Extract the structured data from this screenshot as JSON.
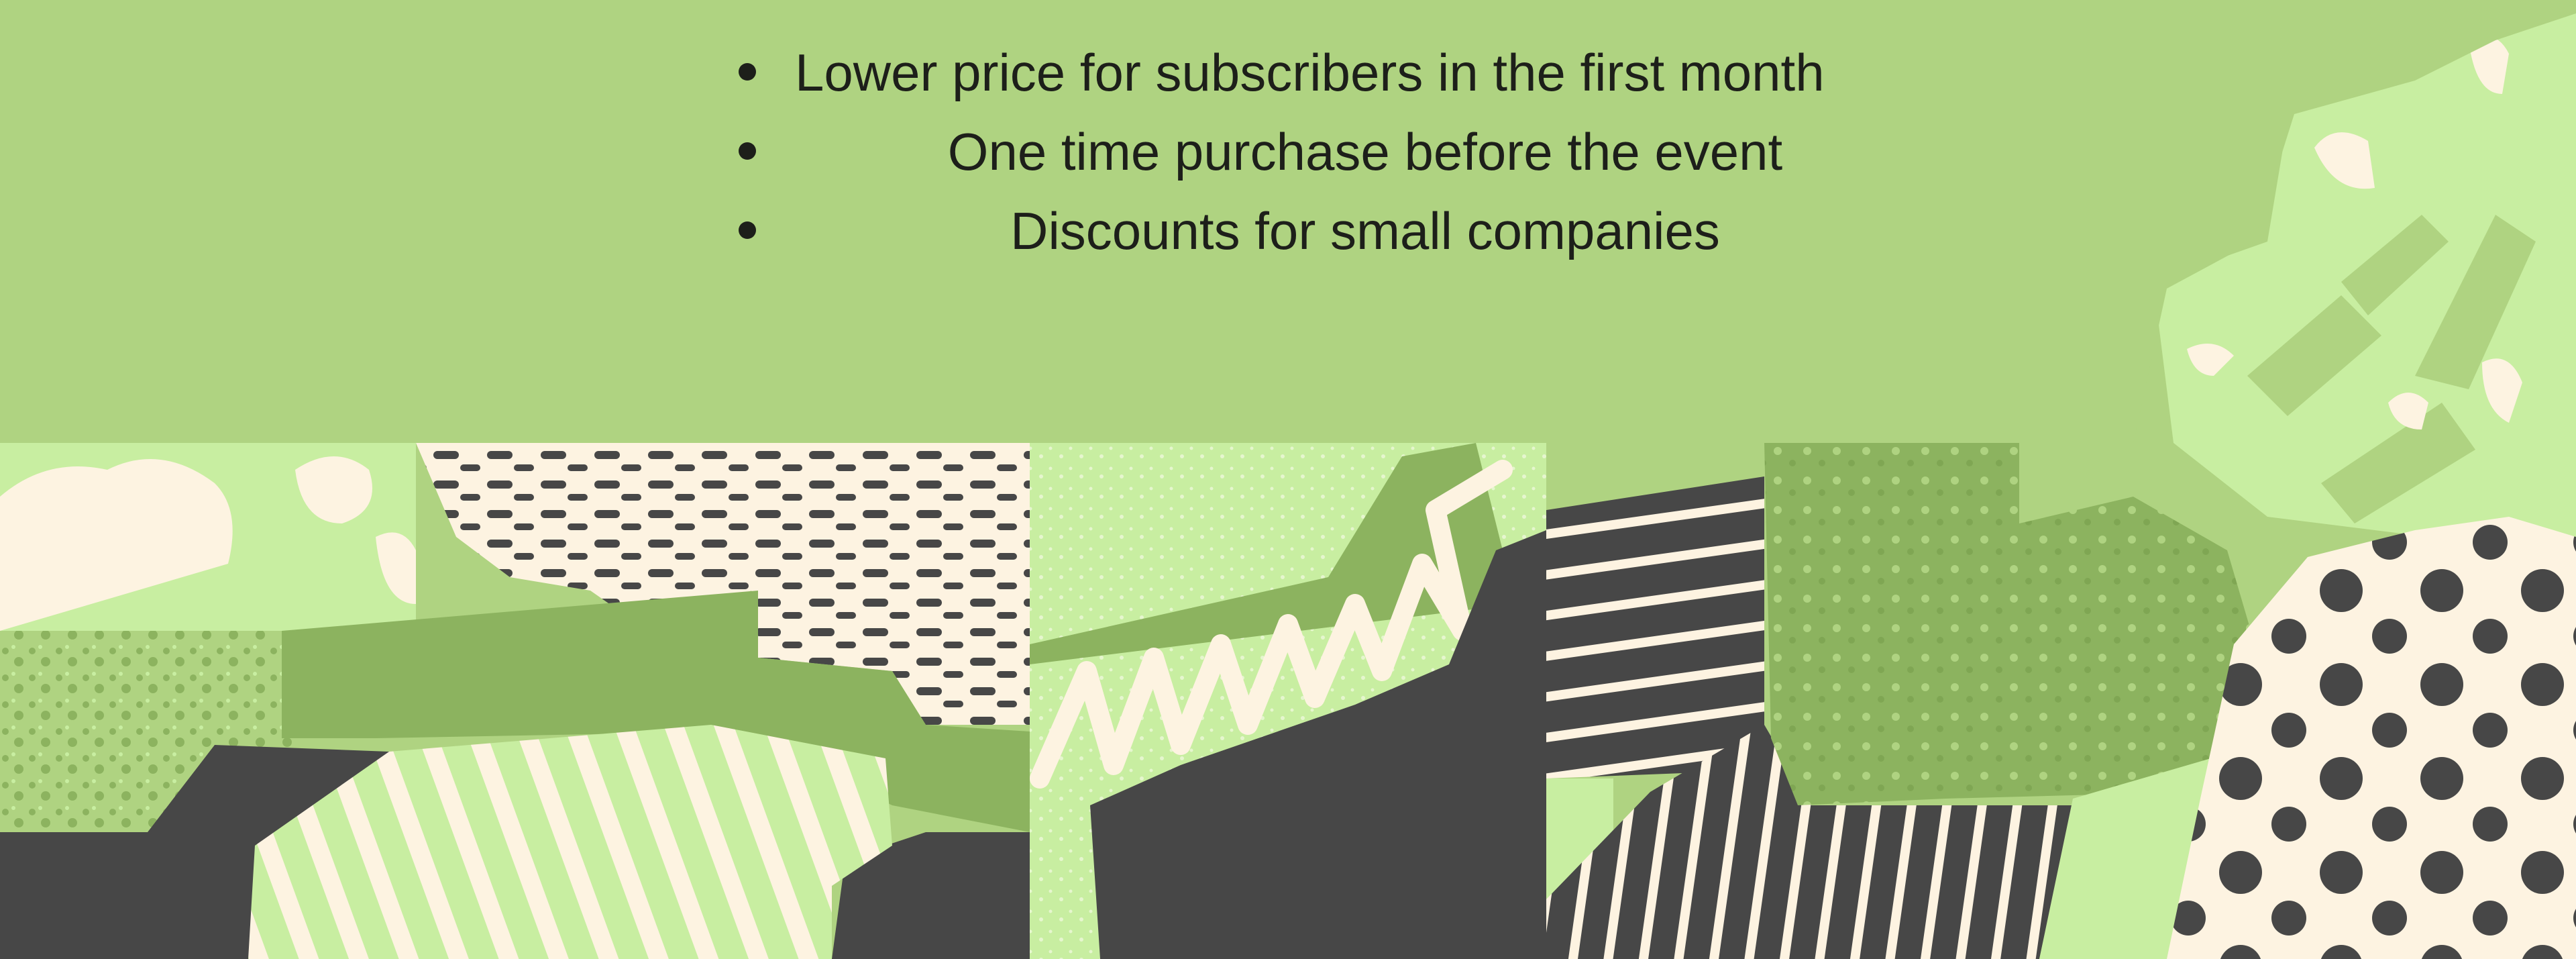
{
  "bullets": [
    "Lower price for subscribers in the first month",
    "One time purchase before the event",
    "Discounts for small companies"
  ],
  "palette": {
    "banner": "#afd381",
    "mid_green": "#8cb35f",
    "light_green": "#c8eea1",
    "cream": "#fdf3e1",
    "charcoal": "#474747"
  }
}
